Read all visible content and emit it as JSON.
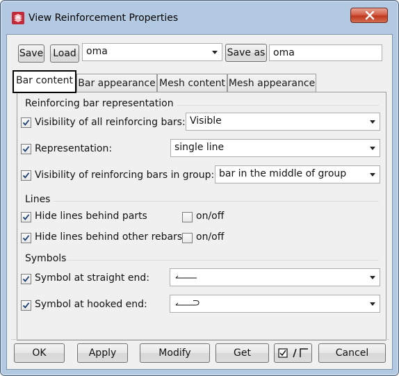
{
  "window": {
    "title": "View Reinforcement Properties"
  },
  "toolbar": {
    "save_label": "Save",
    "load_label": "Load",
    "preset_value": "oma",
    "save_as_label": "Save as",
    "save_as_value": "oma"
  },
  "tabs": [
    {
      "label": "Bar content",
      "active": true
    },
    {
      "label": "Bar appearance",
      "active": false
    },
    {
      "label": "Mesh content",
      "active": false
    },
    {
      "label": "Mesh appearance",
      "active": false
    }
  ],
  "reinforcing_bar_representation": {
    "heading": "Reinforcing bar representation",
    "visibility_all": {
      "label": "Visibility of all reinforcing bars:",
      "checked": true,
      "value": "Visible"
    },
    "representation": {
      "label": "Representation:",
      "checked": true,
      "value": "single line"
    },
    "visibility_group": {
      "label": "Visibility of reinforcing bars in group:",
      "checked": true,
      "value": "bar in the middle of group"
    }
  },
  "lines": {
    "heading": "Lines",
    "hide_behind_parts": {
      "label": "Hide lines behind parts",
      "checked": true,
      "onoff_label": "on/off",
      "onoff_checked": false
    },
    "hide_behind_rebars": {
      "label": "Hide lines behind other rebars",
      "checked": true,
      "onoff_label": "on/off",
      "onoff_checked": false
    }
  },
  "symbols": {
    "heading": "Symbols",
    "straight_end": {
      "label": "Symbol at straight end:",
      "checked": true,
      "symbol_icon": "straight-end-line-icon"
    },
    "hooked_end": {
      "label": "Symbol at hooked end:",
      "checked": true,
      "symbol_icon": "hooked-end-line-icon"
    }
  },
  "buttons": {
    "ok": "OK",
    "apply": "Apply",
    "modify": "Modify",
    "get": "Get",
    "toggle_icon": "check-toggle-icon",
    "cancel": "Cancel"
  },
  "colors": {
    "frame": "#b3c9e1",
    "close_button": "#c0381f",
    "client_background": "#f0f0f0"
  }
}
